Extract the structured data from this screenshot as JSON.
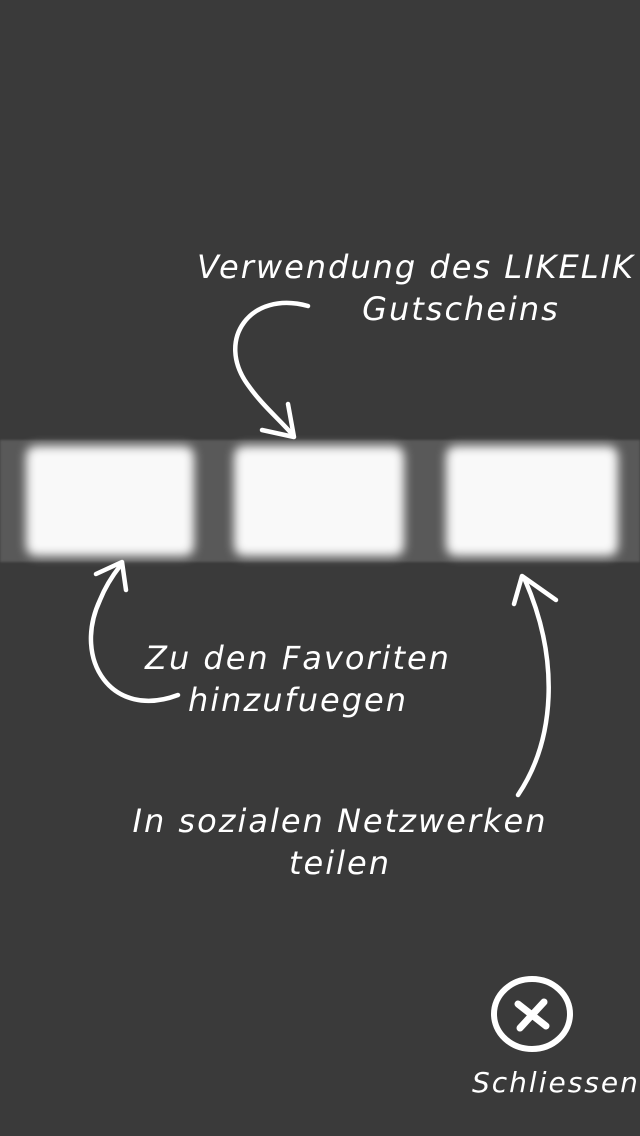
{
  "overlay": {
    "hints": {
      "use_voucher": "Verwendung des LIKELIK Gutscheins",
      "add_favorites": "Zu den Favoriten hinzufuegen",
      "share_social": "In sozialen Netzwerken teilen"
    },
    "hint_lines": {
      "use_voucher_1": "Verwendung des LIKELIK",
      "use_voucher_2": "Gutscheins",
      "add_favorites_1": "Zu den Favoriten",
      "add_favorites_2": "hinzufuegen",
      "share_social_1": "In sozialen Netzwerken",
      "share_social_2": "teilen"
    },
    "close_label": "Schliessen",
    "colors": {
      "background": "#3a3a3a",
      "text": "#ffffff"
    },
    "icons": [
      "close-icon",
      "curved-arrow-icon"
    ]
  }
}
